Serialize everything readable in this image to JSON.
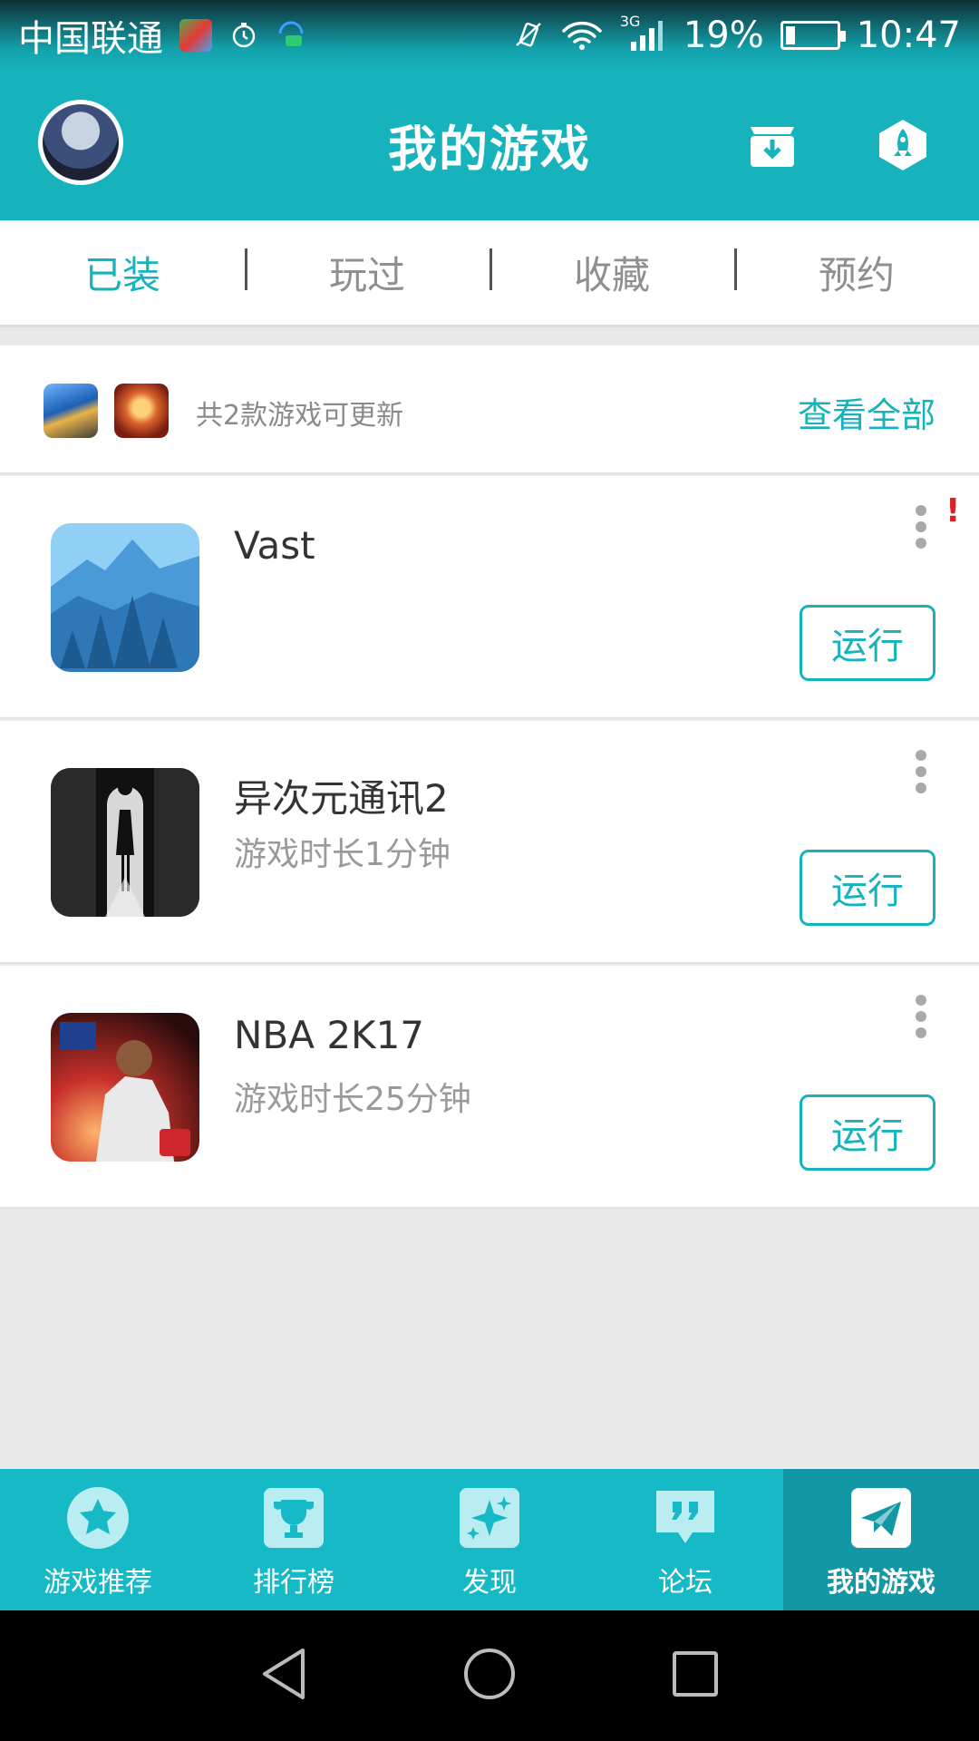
{
  "status_bar": {
    "carrier": "中国联通",
    "network": "3G",
    "battery": "19%",
    "battery_level": 0.19,
    "time": "10:47"
  },
  "header": {
    "title": "我的游戏",
    "avatar": "user-avatar",
    "actions": [
      "download-manager-icon",
      "rocket-boost-icon"
    ]
  },
  "tabs": [
    {
      "label": "已装",
      "active": true
    },
    {
      "label": "玩过",
      "active": false
    },
    {
      "label": "收藏",
      "active": false
    },
    {
      "label": "预约",
      "active": false
    }
  ],
  "update_banner": {
    "text": "共2款游戏可更新",
    "link": "查看全部"
  },
  "games": [
    {
      "name": "Vast",
      "time": "",
      "button": "运行",
      "alert": "!"
    },
    {
      "name": "异次元通讯2",
      "time": "游戏时长1分钟",
      "button": "运行"
    },
    {
      "name": "NBA 2K17",
      "time": "游戏时长25分钟",
      "button": "运行"
    }
  ],
  "bottom_nav": [
    {
      "label": "游戏推荐",
      "icon": "star-icon",
      "active": false
    },
    {
      "label": "排行榜",
      "icon": "trophy-icon",
      "active": false
    },
    {
      "label": "发现",
      "icon": "sparkle-icon",
      "active": false
    },
    {
      "label": "论坛",
      "icon": "quote-bubble-icon",
      "active": false
    },
    {
      "label": "我的游戏",
      "icon": "paper-plane-icon",
      "active": true
    }
  ],
  "colors": {
    "accent": "#16b3bd",
    "nav_bg": "#16b9c6",
    "nav_active": "#1297a4",
    "alert": "#e02020"
  }
}
